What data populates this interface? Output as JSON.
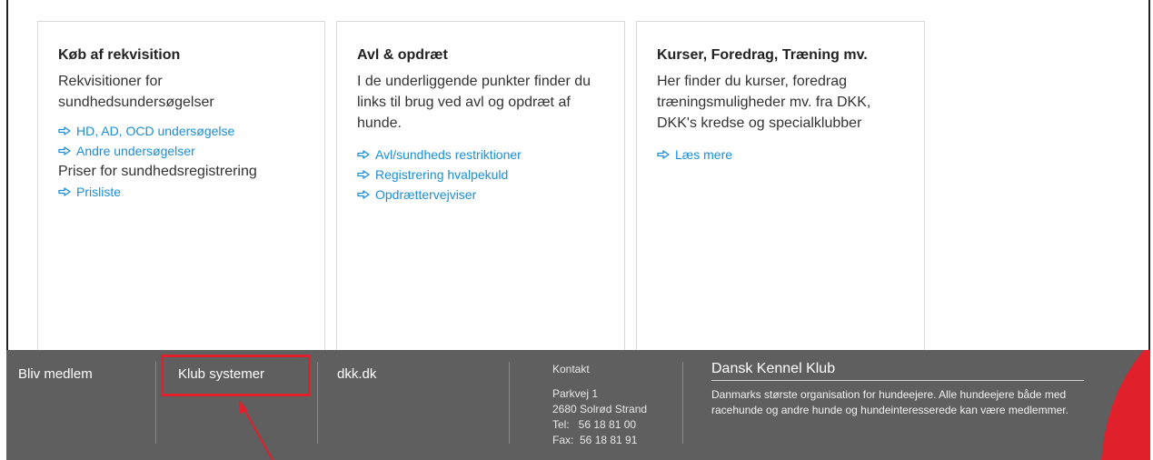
{
  "cards": [
    {
      "title": "Køb af rekvisition",
      "text": "Rekvisitioner for sundhedsundersøgelser",
      "links": [
        "HD, AD, OCD undersøgelse",
        "Andre undersøgelser"
      ],
      "text2": "Priser for sundhedsregistrering",
      "links2": [
        "Prisliste"
      ]
    },
    {
      "title": "Avl & opdræt",
      "text": "I de underliggende punkter finder du links til brug ved avl og opdræt af hunde.",
      "links": [
        "Avl/sundheds restriktioner",
        "Registrering hvalpekuld",
        "Opdrættervejviser"
      ]
    },
    {
      "title": "Kurser, Foredrag, Træning mv.",
      "text": "Her finder du kurser, foredrag træningsmuligheder mv. fra DKK, DKK's kredse og specialklubber",
      "links": [
        "Læs mere"
      ]
    }
  ],
  "footer": {
    "links": [
      "Bliv medlem",
      "Klub systemer",
      "dkk.dk"
    ],
    "contact": {
      "title": "Kontakt",
      "address1": "Parkvej 1",
      "address2": "2680 Solrød Strand",
      "tel": "Tel:   56 18 81 00",
      "fax": "Fax:  56 18 81 91"
    },
    "org": {
      "name": "Dansk Kennel Klub",
      "description": "Danmarks største organisation for hundeejere. Alle hundeejere både med racehunde og andre hunde og hundeinteresserede kan være medlemmer."
    }
  },
  "colors": {
    "link": "#1a8fd6",
    "footer_bg": "#5f5f5f",
    "highlight": "#e0202a"
  },
  "icons": {
    "link_arrow": "arrow-right-outline-icon",
    "logo": "dkk-logo-icon"
  }
}
